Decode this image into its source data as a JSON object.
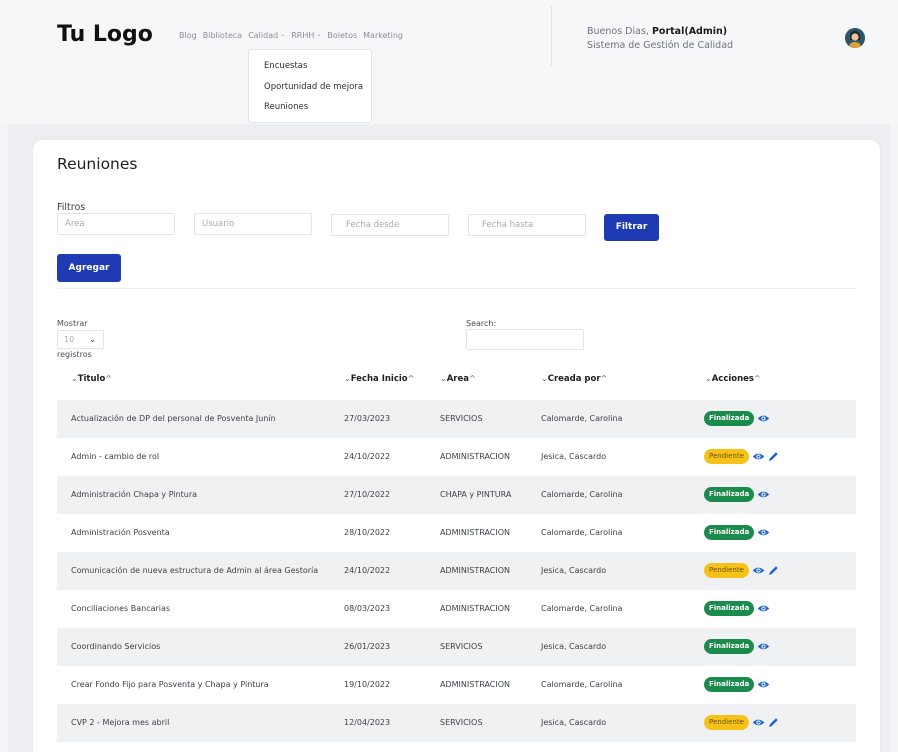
{
  "header": {
    "logo": "Tu Logo",
    "nav": [
      {
        "label": "Blog",
        "dropdown": false
      },
      {
        "label": "Biblioteca",
        "dropdown": false
      },
      {
        "label": "Calidad",
        "dropdown": true
      },
      {
        "label": "RRHH",
        "dropdown": true
      },
      {
        "label": "Boletos",
        "dropdown": false
      },
      {
        "label": "Marketing",
        "dropdown": false
      }
    ],
    "greeting_prefix": "Buenos Dias,",
    "greeting_user": "Portal(Admin)",
    "system_name": "Sistema de Gestión de Calidad",
    "dropdown_items": [
      "Encuestas",
      "Oportunidad de mejora",
      "Reuniones"
    ]
  },
  "page": {
    "title": "Reuniones",
    "filters_label": "Filtros",
    "filter_placeholders": {
      "area": "Area",
      "usuario": "Usuario",
      "fecha_desde": "Fecha desde",
      "fecha_hasta": "Fecha hasta"
    },
    "filter_button": "Filtrar",
    "add_button": "Agregar",
    "mostrar_label": "Mostrar",
    "page_size": "10",
    "registros_label": "registros",
    "search_label": "Search:"
  },
  "table": {
    "columns": [
      "Titulo",
      "Fecha Inicio",
      "Area",
      "Creada por",
      "Acciones"
    ],
    "rows": [
      {
        "titulo": "Actualización de DP del personal de Posventa Junín",
        "fecha": "27/03/2023",
        "area": "SERVICIOS",
        "creada": "Calomarde, Carolina",
        "estado": "Finalizada"
      },
      {
        "titulo": "Admin - cambio de rol",
        "fecha": "24/10/2022",
        "area": "ADMINISTRACION",
        "creada": "Jesica, Cascardo",
        "estado": "Pendiente"
      },
      {
        "titulo": "Administración Chapa y Pintura",
        "fecha": "27/10/2022",
        "area": "CHAPA y PINTURA",
        "creada": "Calomarde, Carolina",
        "estado": "Finalizada"
      },
      {
        "titulo": "Administración Posventa",
        "fecha": "28/10/2022",
        "area": "ADMINISTRACION",
        "creada": "Calomarde, Carolina",
        "estado": "Finalizada"
      },
      {
        "titulo": "Comunicación de nueva estructura de Admin al área Gestoría",
        "fecha": "24/10/2022",
        "area": "ADMINISTRACION",
        "creada": "Jesica, Cascardo",
        "estado": "Pendiente"
      },
      {
        "titulo": "Conciliaciones Bancarias",
        "fecha": "08/03/2023",
        "area": "ADMINISTRACION",
        "creada": "Calomarde, Carolina",
        "estado": "Finalizada"
      },
      {
        "titulo": "Coordinando Servicios",
        "fecha": "26/01/2023",
        "area": "SERVICIOS",
        "creada": "Jesica, Cascardo",
        "estado": "Finalizada"
      },
      {
        "titulo": "Crear Fondo Fijo para Posventa y Chapa y Pintura",
        "fecha": "19/10/2022",
        "area": "ADMINISTRACION",
        "creada": "Calomarde, Carolina",
        "estado": "Finalizada"
      },
      {
        "titulo": "CVP 2 - Mejora mes abril",
        "fecha": "12/04/2023",
        "area": "SERVICIOS",
        "creada": "Jesica, Cascardo",
        "estado": "Pendiente"
      }
    ]
  },
  "colors": {
    "primary": "#1f3bb3",
    "finalizada": "#1b8a4d",
    "pendiente": "#f6c21a",
    "eye_icon": "#1e63c9"
  }
}
